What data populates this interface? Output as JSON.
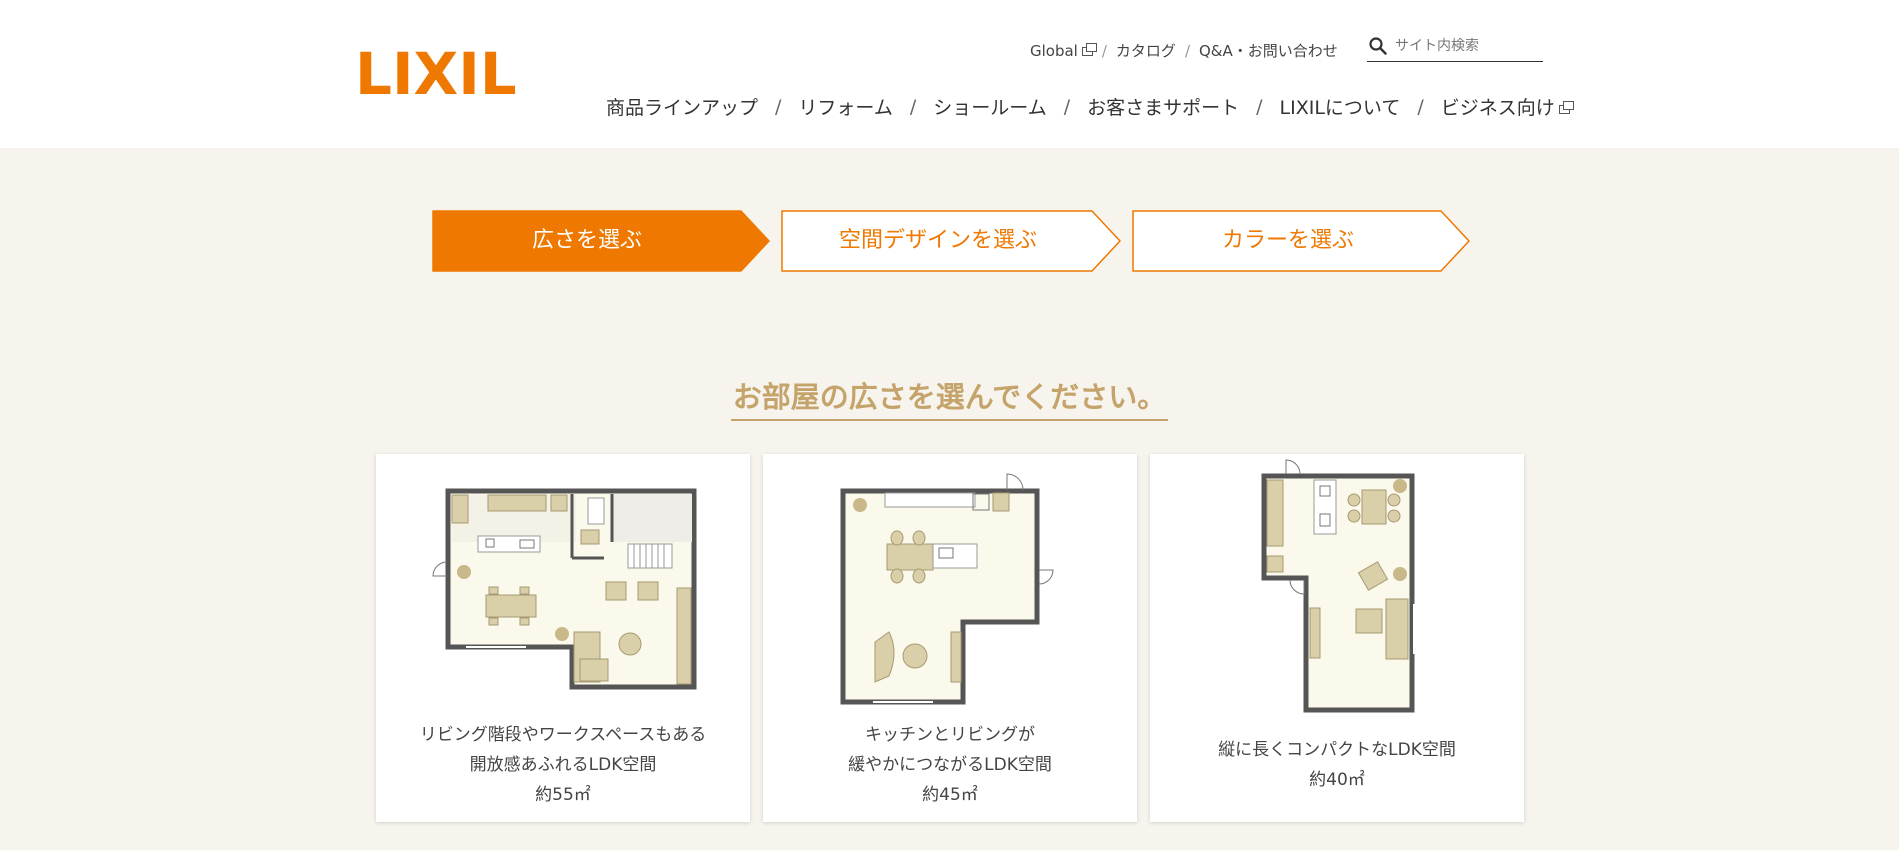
{
  "header": {
    "logo_text": "LIXIL",
    "utility_links": [
      {
        "label": "Global"
      },
      {
        "label": "カタログ"
      },
      {
        "label": "Q&A・お問い合わせ"
      }
    ],
    "separator": "/",
    "search": {
      "placeholder": "サイト内検索"
    },
    "main_nav": [
      {
        "label": "商品ラインアップ"
      },
      {
        "label": "リフォーム"
      },
      {
        "label": "ショールーム"
      },
      {
        "label": "お客さまサポート"
      },
      {
        "label": "LIXILについて"
      },
      {
        "label": "ビジネス向け"
      }
    ]
  },
  "steps": [
    {
      "label": "広さを選ぶ",
      "active": true
    },
    {
      "label": "空間デザインを選ぶ",
      "active": false
    },
    {
      "label": "カラーを選ぶ",
      "active": false
    }
  ],
  "heading": "お部屋の広さを選んでください。",
  "cards": [
    {
      "line1": "リビング階段やワークスペースもある",
      "line2": "開放感あふれるLDK空間",
      "area": "約55㎡"
    },
    {
      "line1": "キッチンとリビングが",
      "line2": "緩やかにつながるLDK空間",
      "area": "約45㎡"
    },
    {
      "line1": "縦に長くコンパクトなLDK空間",
      "area": "約40㎡"
    }
  ],
  "colors": {
    "brand": "#ee7800",
    "accent": "#c4a46b",
    "background": "#f7f4ee"
  }
}
